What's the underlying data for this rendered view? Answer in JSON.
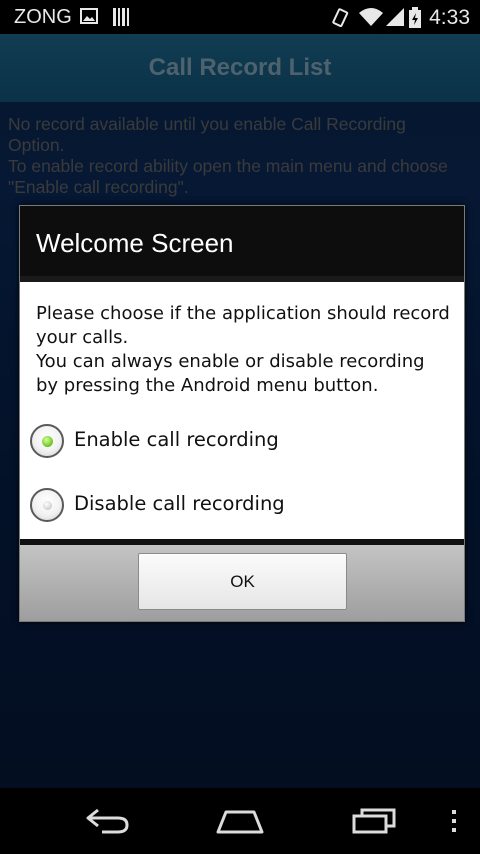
{
  "status_bar": {
    "carrier": "ZONG",
    "time": "4:33",
    "icons": [
      "image-icon",
      "barcode-icon",
      "vibrate-icon",
      "wifi-icon",
      "signal-icon",
      "battery-icon"
    ]
  },
  "app": {
    "title": "Call Record List",
    "info_line1": "No record available until you enable Call Recording Option.",
    "info_line2": "To enable record ability open the main menu and choose \"Enable call recording\"."
  },
  "dialog": {
    "title": "Welcome Screen",
    "message_line1": "Please choose if the application should record your calls.",
    "message_line2": "You can always enable or disable recording by pressing the Android menu button.",
    "options": [
      {
        "label": "Enable call recording",
        "selected": true
      },
      {
        "label": "Disable call recording",
        "selected": false
      }
    ],
    "ok_label": "OK"
  },
  "nav_bar": {
    "icons": [
      "back-icon",
      "home-icon",
      "recent-apps-icon",
      "menu-icon"
    ]
  },
  "colors": {
    "title_bar": "#1f6f95",
    "app_background": "#0b2c5e",
    "radio_selected": "#6ac31a"
  }
}
